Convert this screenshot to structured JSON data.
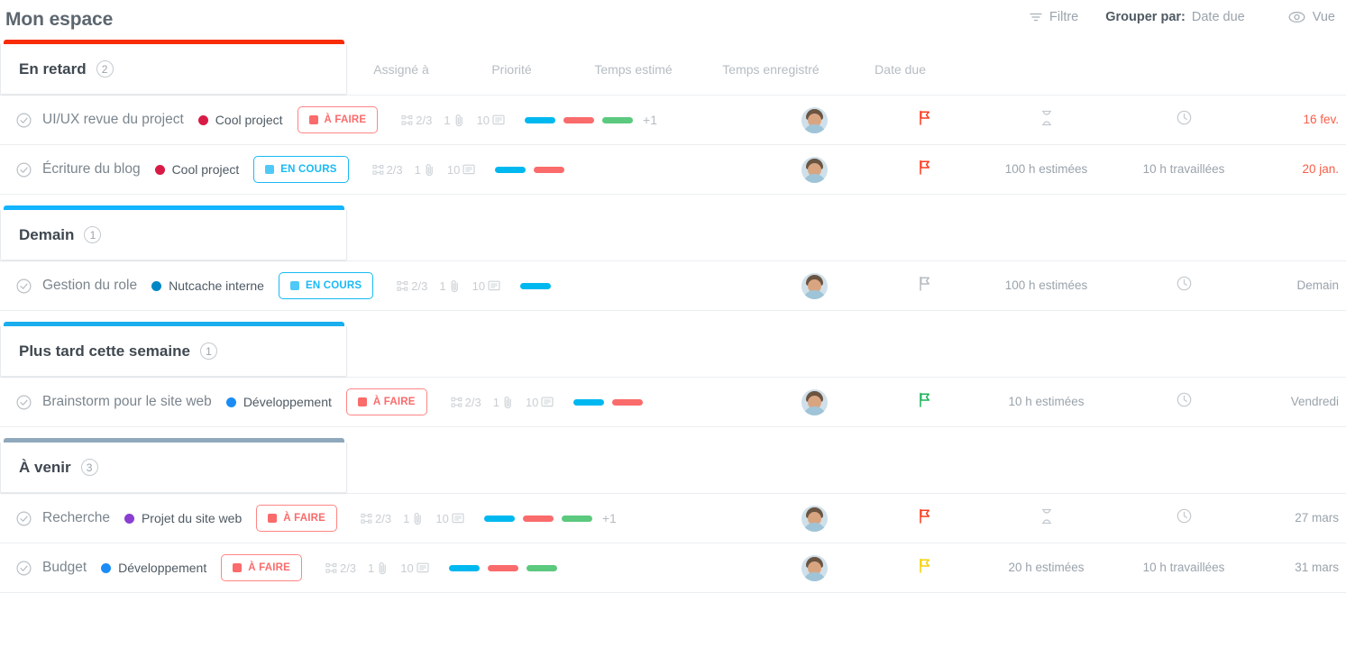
{
  "header": {
    "title": "Mon espace",
    "filter_label": "Filtre",
    "group_by_label": "Grouper par:",
    "group_by_value": "Date due",
    "view_label": "Vue",
    "filter_icon": "filter-icon",
    "eye_icon": "eye-icon"
  },
  "columns": {
    "assignee": "Assigné à",
    "priority": "Priorité",
    "estimated": "Temps estimé",
    "logged": "Temps enregistré",
    "due": "Date due"
  },
  "colors": {
    "overdue_bar": "#f92c0a",
    "tomorrow_bar": "#13b5ff",
    "later_bar": "#1aaeee",
    "upcoming_bar": "#8fa8bc",
    "todo_border": "#ff8585",
    "todo_text": "#fa6b6b",
    "todo_square": "#fa6b6b",
    "inprogress_border": "#19b9f5",
    "inprogress_text": "#19b9f5",
    "inprogress_square": "#4fc9f8",
    "tag_cyan": "#00b8f0",
    "tag_red": "#fa6b6b",
    "tag_green": "#5bc97e",
    "project_cool": "#d81b45",
    "project_nutcache": "#0087c4",
    "project_dev": "#1b8cf5",
    "project_site": "#8a3fd1",
    "flag_red": "#fa3c1e",
    "flag_green": "#1bb35c",
    "flag_yellow": "#f7d000",
    "flag_gray": "#b6bcc2",
    "due_late": "#fa5d48"
  },
  "groups": [
    {
      "name": "En retard",
      "count": "2",
      "bar_color": "#f92c0a",
      "tasks": [
        {
          "name": "UI/UX revue du project",
          "project": "Cool project",
          "project_color": "#d81b45",
          "status": "À FAIRE",
          "status_kind": "todo",
          "subtasks": "2/3",
          "attachments": "1",
          "comments": "10",
          "tags": [
            "#00b8f0",
            "#fa6b6b",
            "#5bc97e"
          ],
          "tags_more": "+1",
          "priority_color": "#fa3c1e",
          "estimated": "",
          "estimated_icon": "hourglass-icon",
          "logged": "",
          "logged_icon": "clock-icon",
          "due": "16 fev.",
          "due_late": true
        },
        {
          "name": "Écriture du blog",
          "project": "Cool project",
          "project_color": "#d81b45",
          "status": "EN COURS",
          "status_kind": "inprogress",
          "subtasks": "2/3",
          "attachments": "1",
          "comments": "10",
          "tags": [
            "#00b8f0",
            "#fa6b6b"
          ],
          "tags_more": "",
          "priority_color": "#fa3c1e",
          "estimated": "100 h estimées",
          "estimated_icon": "",
          "logged": "10 h travaillées",
          "logged_icon": "",
          "due": "20 jan.",
          "due_late": true
        }
      ]
    },
    {
      "name": "Demain",
      "count": "1",
      "bar_color": "#13b5ff",
      "tasks": [
        {
          "name": "Gestion du role",
          "project": "Nutcache interne",
          "project_color": "#0087c4",
          "status": "EN COURS",
          "status_kind": "inprogress",
          "subtasks": "2/3",
          "attachments": "1",
          "comments": "10",
          "tags": [
            "#00b8f0"
          ],
          "tags_more": "",
          "priority_color": "#b6bcc2",
          "estimated": "100 h estimées",
          "estimated_icon": "",
          "logged": "",
          "logged_icon": "clock-icon",
          "due": "Demain",
          "due_late": false
        }
      ]
    },
    {
      "name": "Plus tard cette semaine",
      "count": "1",
      "bar_color": "#1aaeee",
      "tasks": [
        {
          "name": "Brainstorm pour le site web",
          "project": "Développement",
          "project_color": "#1b8cf5",
          "status": "À FAIRE",
          "status_kind": "todo",
          "subtasks": "2/3",
          "attachments": "1",
          "comments": "10",
          "tags": [
            "#00b8f0",
            "#fa6b6b"
          ],
          "tags_more": "",
          "priority_color": "#1bb35c",
          "estimated": "10 h estimées",
          "estimated_icon": "",
          "logged": "",
          "logged_icon": "clock-icon",
          "due": "Vendredi",
          "due_late": false
        }
      ]
    },
    {
      "name": "À venir",
      "count": "3",
      "bar_color": "#8fa8bc",
      "tasks": [
        {
          "name": "Recherche",
          "project": "Projet du site web",
          "project_color": "#8a3fd1",
          "status": "À FAIRE",
          "status_kind": "todo",
          "subtasks": "2/3",
          "attachments": "1",
          "comments": "10",
          "tags": [
            "#00b8f0",
            "#fa6b6b",
            "#5bc97e"
          ],
          "tags_more": "+1",
          "priority_color": "#fa3c1e",
          "estimated": "",
          "estimated_icon": "hourglass-icon",
          "logged": "",
          "logged_icon": "clock-icon",
          "due": "27 mars",
          "due_late": false
        },
        {
          "name": "Budget",
          "project": "Développement",
          "project_color": "#1b8cf5",
          "status": "À FAIRE",
          "status_kind": "todo",
          "subtasks": "2/3",
          "attachments": "1",
          "comments": "10",
          "tags": [
            "#00b8f0",
            "#fa6b6b",
            "#5bc97e"
          ],
          "tags_more": "",
          "priority_color": "#f7d000",
          "estimated": "20 h estimées",
          "estimated_icon": "",
          "logged": "10 h travaillées",
          "logged_icon": "",
          "due": "31 mars",
          "due_late": false
        }
      ]
    }
  ]
}
